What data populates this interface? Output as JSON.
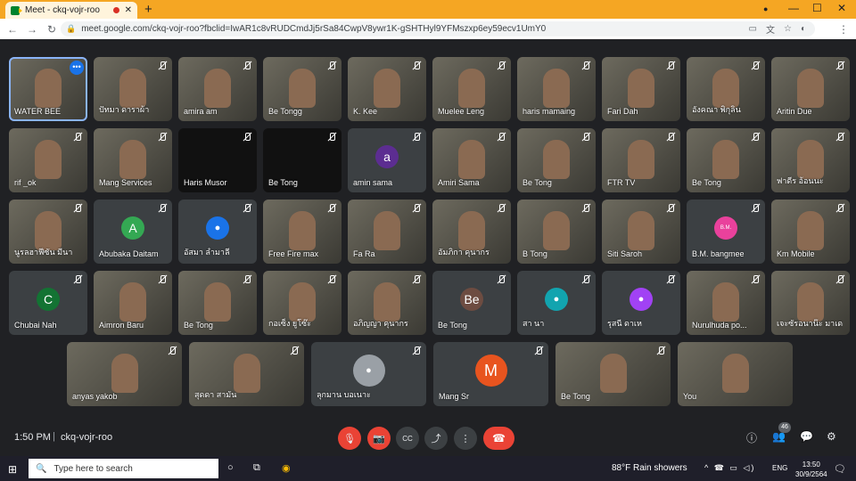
{
  "browser": {
    "tab_title": "Meet - ckq-vojr-roo",
    "tab_close": "✕",
    "new_tab": "+",
    "url": "meet.google.com/ckq-vojr-roo?fbclid=IwAR1c8vRUDCmdJj5rSa84CwpV8ywr1K-gSHTHyl9YFMszxp6ey59ecv1UmY0",
    "back": "←",
    "forward": "→",
    "reload": "↻",
    "lock": "🔒",
    "minimize": "—",
    "maximize": "☐",
    "close": "✕",
    "profile_dot": "●",
    "menu": "⋮"
  },
  "participants_row1": [
    {
      "name": "WATER BEE",
      "kind": "photo"
    },
    {
      "name": "ปัทมา ดาราผ้า",
      "kind": "photo"
    },
    {
      "name": "amira am",
      "kind": "photo"
    },
    {
      "name": "Be Tongg",
      "kind": "photo"
    },
    {
      "name": "K. Kee",
      "kind": "photo"
    },
    {
      "name": "Muelee Leng",
      "kind": "photo"
    },
    {
      "name": "haris mamaing",
      "kind": "photo"
    },
    {
      "name": "Fari Dah",
      "kind": "photo"
    },
    {
      "name": "อังคณา พิกุลิน",
      "kind": "photo"
    },
    {
      "name": "Aritin Due",
      "kind": "photo"
    }
  ],
  "participants_row2": [
    {
      "name": "rif _ok",
      "kind": "photo"
    },
    {
      "name": "Mang Services",
      "kind": "photo"
    },
    {
      "name": "Haris Musor",
      "kind": "dark"
    },
    {
      "name": "Be Tong",
      "kind": "dark"
    },
    {
      "name": "amin sama",
      "kind": "avatar",
      "initial": "a",
      "color": "#5c2d91"
    },
    {
      "name": "Amiri Sama",
      "kind": "photo"
    },
    {
      "name": "Be Tong",
      "kind": "photo"
    },
    {
      "name": "FTR TV",
      "kind": "photo"
    },
    {
      "name": "Be Tong",
      "kind": "photo"
    },
    {
      "name": "ฟาดีร อ้อนนะ",
      "kind": "photo"
    }
  ],
  "participants_row3": [
    {
      "name": "นูรลฮาฟีซัน มีนา",
      "kind": "photo"
    },
    {
      "name": "Abubaka Daitam",
      "kind": "avatar",
      "initial": "A",
      "color": "#34a853"
    },
    {
      "name": "อัสมา ลำมาลี",
      "kind": "avatar-person",
      "color": "#1a73e8"
    },
    {
      "name": "Free Fire max",
      "kind": "photo"
    },
    {
      "name": "Fa Ra",
      "kind": "photo"
    },
    {
      "name": "อัมภิกา คุนากร",
      "kind": "photo"
    },
    {
      "name": "B Tong",
      "kind": "photo"
    },
    {
      "name": "Siti Saroh",
      "kind": "photo"
    },
    {
      "name": "B.M. bangmee",
      "kind": "avatar",
      "initial": "B.M.",
      "color": "#e9419c"
    },
    {
      "name": "Km Mobile",
      "kind": "photo"
    }
  ],
  "participants_row4": [
    {
      "name": "Chubai Nah",
      "kind": "avatar",
      "initial": "C",
      "color": "#137333"
    },
    {
      "name": "Aimron Baru",
      "kind": "photo"
    },
    {
      "name": "Be Tong",
      "kind": "photo"
    },
    {
      "name": "กอเซ็ง ยูโซ๊ะ",
      "kind": "photo"
    },
    {
      "name": "อภิญญา คุนากร",
      "kind": "photo"
    },
    {
      "name": "Be Tong",
      "kind": "avatar",
      "initial": "Be",
      "color": "#6d4c41"
    },
    {
      "name": "สา นา",
      "kind": "avatar-person",
      "color": "#12a4af"
    },
    {
      "name": "รุสนี ดาเห",
      "kind": "avatar-person",
      "color": "#a142f4"
    },
    {
      "name": "Nurulhuda po...",
      "kind": "photo"
    },
    {
      "name": "เจะซัรอนาน๊ะ มาเด",
      "kind": "photo"
    }
  ],
  "participants_row5": [
    {
      "name": "anyas yakob",
      "kind": "photo"
    },
    {
      "name": "สุดดา สามัน",
      "kind": "photo"
    },
    {
      "name": "ลุกมาน บอเนาะ",
      "kind": "avatar-person",
      "color": "#9aa0a6"
    },
    {
      "name": "Mang Sr",
      "kind": "avatar",
      "initial": "M",
      "color": "#e8541f"
    },
    {
      "name": "Be Tong",
      "kind": "photo"
    },
    {
      "name": "You",
      "kind": "photo"
    }
  ],
  "meeting": {
    "time": "1:50 PM",
    "separator": "|",
    "code": "ckq-vojr-roo",
    "people_count": "46"
  },
  "controls": {
    "mic": "🎙",
    "camera": "📷",
    "captions": "CC",
    "present": "⤴",
    "more": "⋮",
    "hangup": "☎",
    "info": "ⓘ",
    "people": "👥",
    "chat": "💬",
    "activities": "⚙"
  },
  "taskbar": {
    "start": "⊞",
    "search_placeholder": "Type here to search",
    "search_icon": "🔍",
    "task_view": "○",
    "multitask": "⧉",
    "chrome": "◉",
    "weather": "88°F  Rain showers",
    "tray": "^ ☎ ▭ ◁)",
    "lang": "ENG",
    "clock_time": "13:50",
    "clock_date": "30/9/2564",
    "notifications": "🗨"
  }
}
